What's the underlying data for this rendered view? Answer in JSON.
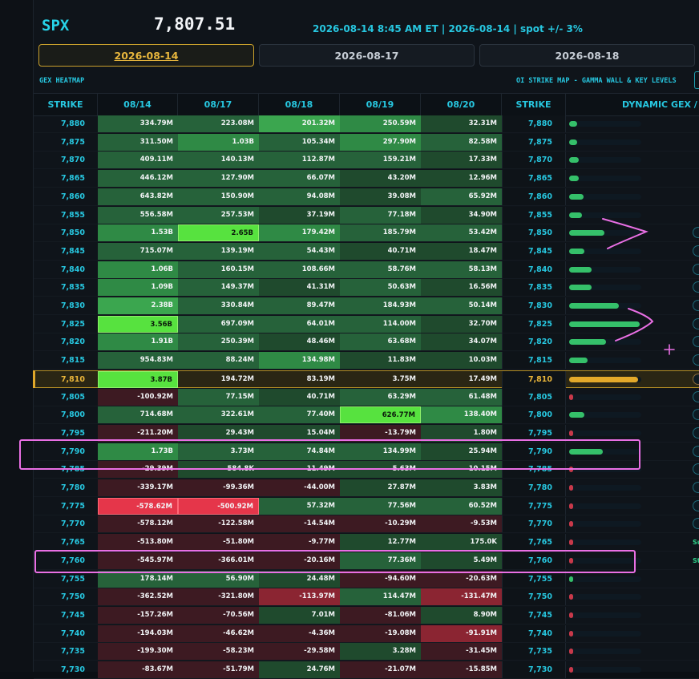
{
  "header": {
    "symbol": "SPX",
    "spot_price": "7,807.51",
    "meta": "2026-08-14 8:45 AM ET | 2026-08-14 | spot +/- 3%"
  },
  "expiry_tabs": [
    {
      "label": "2026-08-14",
      "active": true
    },
    {
      "label": "2026-08-17",
      "active": false
    },
    {
      "label": "2026-08-18",
      "active": false
    }
  ],
  "sections": {
    "left": "GEX HEATMAP",
    "right": "OI STRIKE MAP - GAMMA WALL & KEY LEVELS"
  },
  "table": {
    "columns": [
      "STRIKE",
      "08/14",
      "08/17",
      "08/18",
      "08/19",
      "08/20",
      "STRIKE",
      "DYNAMIC GEX / ST"
    ],
    "rows": [
      {
        "strike": "7,880",
        "cells": [
          {
            "v": "334.79M",
            "t": 2
          },
          {
            "v": "223.08M",
            "t": 2
          },
          {
            "v": "201.32M",
            "t": 4
          },
          {
            "v": "250.59M",
            "t": 3
          },
          {
            "v": "32.31M",
            "t": 1
          }
        ],
        "bar": 0.11,
        "badge": false
      },
      {
        "strike": "7,875",
        "cells": [
          {
            "v": "311.50M",
            "t": 2
          },
          {
            "v": "1.03B",
            "t": 3
          },
          {
            "v": "105.34M",
            "t": 2
          },
          {
            "v": "297.90M",
            "t": 3
          },
          {
            "v": "82.58M",
            "t": 2
          }
        ],
        "bar": 0.11,
        "badge": false
      },
      {
        "strike": "7,870",
        "cells": [
          {
            "v": "409.11M",
            "t": 2
          },
          {
            "v": "140.13M",
            "t": 2
          },
          {
            "v": "112.87M",
            "t": 2
          },
          {
            "v": "159.21M",
            "t": 2
          },
          {
            "v": "17.33M",
            "t": 1
          }
        ],
        "bar": 0.14,
        "badge": false
      },
      {
        "strike": "7,865",
        "cells": [
          {
            "v": "446.12M",
            "t": 2
          },
          {
            "v": "127.90M",
            "t": 2
          },
          {
            "v": "66.07M",
            "t": 2
          },
          {
            "v": "43.20M",
            "t": 1
          },
          {
            "v": "12.96M",
            "t": 1
          }
        ],
        "bar": 0.14,
        "badge": false
      },
      {
        "strike": "7,860",
        "cells": [
          {
            "v": "643.82M",
            "t": 2
          },
          {
            "v": "150.90M",
            "t": 2
          },
          {
            "v": "94.08M",
            "t": 2
          },
          {
            "v": "39.08M",
            "t": 1
          },
          {
            "v": "65.92M",
            "t": 2
          }
        ],
        "bar": 0.2,
        "badge": false
      },
      {
        "strike": "7,855",
        "cells": [
          {
            "v": "556.58M",
            "t": 2
          },
          {
            "v": "257.53M",
            "t": 2
          },
          {
            "v": "37.19M",
            "t": 1
          },
          {
            "v": "77.18M",
            "t": 2
          },
          {
            "v": "34.90M",
            "t": 1
          }
        ],
        "bar": 0.18,
        "badge": false
      },
      {
        "strike": "7,850",
        "cells": [
          {
            "v": "1.53B",
            "t": 3
          },
          {
            "v": "2.65B",
            "t": 5
          },
          {
            "v": "179.42M",
            "t": 3
          },
          {
            "v": "185.79M",
            "t": 2
          },
          {
            "v": "53.42M",
            "t": 2
          }
        ],
        "bar": 0.5,
        "badge": true
      },
      {
        "strike": "7,845",
        "cells": [
          {
            "v": "715.07M",
            "t": 2
          },
          {
            "v": "139.19M",
            "t": 2
          },
          {
            "v": "54.43M",
            "t": 2
          },
          {
            "v": "40.71M",
            "t": 1
          },
          {
            "v": "18.47M",
            "t": 1
          }
        ],
        "bar": 0.22,
        "badge": true
      },
      {
        "strike": "7,840",
        "cells": [
          {
            "v": "1.06B",
            "t": 3
          },
          {
            "v": "160.15M",
            "t": 2
          },
          {
            "v": "108.66M",
            "t": 2
          },
          {
            "v": "58.76M",
            "t": 2
          },
          {
            "v": "58.13M",
            "t": 2
          }
        ],
        "bar": 0.32,
        "badge": true
      },
      {
        "strike": "7,835",
        "cells": [
          {
            "v": "1.09B",
            "t": 3
          },
          {
            "v": "149.37M",
            "t": 2
          },
          {
            "v": "41.31M",
            "t": 1
          },
          {
            "v": "50.63M",
            "t": 2
          },
          {
            "v": "16.56M",
            "t": 1
          }
        ],
        "bar": 0.32,
        "badge": true
      },
      {
        "strike": "7,830",
        "cells": [
          {
            "v": "2.38B",
            "t": 4
          },
          {
            "v": "330.84M",
            "t": 2
          },
          {
            "v": "89.47M",
            "t": 2
          },
          {
            "v": "184.93M",
            "t": 2
          },
          {
            "v": "50.14M",
            "t": 2
          }
        ],
        "bar": 0.7,
        "badge": true
      },
      {
        "strike": "7,825",
        "cells": [
          {
            "v": "3.56B",
            "t": 5
          },
          {
            "v": "697.09M",
            "t": 2
          },
          {
            "v": "64.01M",
            "t": 2
          },
          {
            "v": "114.00M",
            "t": 2
          },
          {
            "v": "32.70M",
            "t": 1
          }
        ],
        "bar": 1.0,
        "badge": true
      },
      {
        "strike": "7,820",
        "cells": [
          {
            "v": "1.91B",
            "t": 3
          },
          {
            "v": "250.39M",
            "t": 2
          },
          {
            "v": "48.46M",
            "t": 1
          },
          {
            "v": "63.68M",
            "t": 2
          },
          {
            "v": "34.07M",
            "t": 1
          }
        ],
        "bar": 0.52,
        "badge": true
      },
      {
        "strike": "7,815",
        "cells": [
          {
            "v": "954.83M",
            "t": 2
          },
          {
            "v": "88.24M",
            "t": 2
          },
          {
            "v": "134.98M",
            "t": 3
          },
          {
            "v": "11.83M",
            "t": 1
          },
          {
            "v": "10.03M",
            "t": 1
          }
        ],
        "bar": 0.26,
        "badge": true
      },
      {
        "strike": "7,810",
        "spot": true,
        "cells": [
          {
            "v": "3.87B",
            "t": 5
          },
          {
            "v": "194.72M",
            "t": 0
          },
          {
            "v": "83.19M",
            "t": 0
          },
          {
            "v": "3.75M",
            "t": 0
          },
          {
            "v": "17.49M",
            "t": 0
          }
        ],
        "bar": 0.98,
        "badge": true
      },
      {
        "strike": "7,805",
        "cells": [
          {
            "v": "-100.92M",
            "t": -1
          },
          {
            "v": "77.15M",
            "t": 2
          },
          {
            "v": "40.71M",
            "t": 1
          },
          {
            "v": "63.29M",
            "t": 2
          },
          {
            "v": "61.48M",
            "t": 2
          }
        ],
        "bar": -0.02,
        "badge": true
      },
      {
        "strike": "7,800",
        "cells": [
          {
            "v": "714.68M",
            "t": 2
          },
          {
            "v": "322.61M",
            "t": 2
          },
          {
            "v": "77.40M",
            "t": 2
          },
          {
            "v": "626.77M",
            "t": 5
          },
          {
            "v": "138.40M",
            "t": 3
          }
        ],
        "bar": 0.22,
        "badge": true
      },
      {
        "strike": "7,795",
        "cells": [
          {
            "v": "-211.20M",
            "t": -1
          },
          {
            "v": "29.43M",
            "t": 1
          },
          {
            "v": "15.04M",
            "t": 1
          },
          {
            "v": "-13.79M",
            "t": -1
          },
          {
            "v": "1.80M",
            "t": 1
          }
        ],
        "bar": -0.02,
        "badge": true
      },
      {
        "strike": "7,790",
        "cells": [
          {
            "v": "1.73B",
            "t": 3
          },
          {
            "v": "3.73M",
            "t": 2
          },
          {
            "v": "74.84M",
            "t": 2
          },
          {
            "v": "134.99M",
            "t": 2
          },
          {
            "v": "25.94M",
            "t": 1
          }
        ],
        "bar": 0.48,
        "badge": true
      },
      {
        "strike": "7,785",
        "cells": [
          {
            "v": "-29.39M",
            "t": -1
          },
          {
            "v": "584.8K",
            "t": 1
          },
          {
            "v": "11.49M",
            "t": 1
          },
          {
            "v": "5.63M",
            "t": 1
          },
          {
            "v": "10.15M",
            "t": 1
          }
        ],
        "bar": -0.01,
        "badge": true
      },
      {
        "strike": "7,780",
        "cells": [
          {
            "v": "-339.17M",
            "t": -1
          },
          {
            "v": "-99.36M",
            "t": -1
          },
          {
            "v": "-44.00M",
            "t": -1
          },
          {
            "v": "27.87M",
            "t": 1
          },
          {
            "v": "3.83M",
            "t": 1
          }
        ],
        "bar": -0.02,
        "badge": true
      },
      {
        "strike": "7,775",
        "cells": [
          {
            "v": "-578.62M",
            "t": -3
          },
          {
            "v": "-500.92M",
            "t": -3
          },
          {
            "v": "57.32M",
            "t": 2
          },
          {
            "v": "77.56M",
            "t": 2
          },
          {
            "v": "60.52M",
            "t": 2
          }
        ],
        "bar": -0.04,
        "badge": true
      },
      {
        "strike": "7,770",
        "cells": [
          {
            "v": "-578.12M",
            "t": -1
          },
          {
            "v": "-122.58M",
            "t": -1
          },
          {
            "v": "-14.54M",
            "t": -1
          },
          {
            "v": "-10.29M",
            "t": -1
          },
          {
            "v": "-9.53M",
            "t": -1
          }
        ],
        "bar": -0.04,
        "badge": true
      },
      {
        "strike": "7,765",
        "cells": [
          {
            "v": "-513.80M",
            "t": -1
          },
          {
            "v": "-51.80M",
            "t": -1
          },
          {
            "v": "-9.77M",
            "t": -1
          },
          {
            "v": "12.77M",
            "t": 1
          },
          {
            "v": "175.0K",
            "t": 1
          }
        ],
        "bar": -0.04,
        "badge": false,
        "side": "Su"
      },
      {
        "strike": "7,760",
        "cells": [
          {
            "v": "-545.97M",
            "t": -1
          },
          {
            "v": "-366.01M",
            "t": -1
          },
          {
            "v": "-20.16M",
            "t": -1
          },
          {
            "v": "77.36M",
            "t": 2
          },
          {
            "v": "5.49M",
            "t": 1
          }
        ],
        "bar": -0.04,
        "badge": false,
        "side": "St"
      },
      {
        "strike": "7,755",
        "cells": [
          {
            "v": "178.14M",
            "t": 2
          },
          {
            "v": "56.90M",
            "t": 2
          },
          {
            "v": "24.48M",
            "t": 1
          },
          {
            "v": "-94.60M",
            "t": -1
          },
          {
            "v": "-20.63M",
            "t": -1
          }
        ],
        "bar": 0.03,
        "badge": false
      },
      {
        "strike": "7,750",
        "cells": [
          {
            "v": "-362.52M",
            "t": -1
          },
          {
            "v": "-321.80M",
            "t": -1
          },
          {
            "v": "-113.97M",
            "t": -2
          },
          {
            "v": "114.47M",
            "t": 2
          },
          {
            "v": "-131.47M",
            "t": -2
          }
        ],
        "bar": -0.01,
        "badge": false
      },
      {
        "strike": "7,745",
        "cells": [
          {
            "v": "-157.26M",
            "t": -1
          },
          {
            "v": "-70.56M",
            "t": -1
          },
          {
            "v": "7.01M",
            "t": 1
          },
          {
            "v": "-81.06M",
            "t": -1
          },
          {
            "v": "8.90M",
            "t": 1
          }
        ],
        "bar": -0.01,
        "badge": false
      },
      {
        "strike": "7,740",
        "cells": [
          {
            "v": "-194.03M",
            "t": -1
          },
          {
            "v": "-46.62M",
            "t": -1
          },
          {
            "v": "-4.36M",
            "t": -1
          },
          {
            "v": "-19.08M",
            "t": -1
          },
          {
            "v": "-91.91M",
            "t": -2
          }
        ],
        "bar": -0.01,
        "badge": false
      },
      {
        "strike": "7,735",
        "cells": [
          {
            "v": "-199.30M",
            "t": -1
          },
          {
            "v": "-58.23M",
            "t": -1
          },
          {
            "v": "-29.58M",
            "t": -1
          },
          {
            "v": "3.28M",
            "t": 1
          },
          {
            "v": "-31.45M",
            "t": -1
          }
        ],
        "bar": -0.01,
        "badge": false
      },
      {
        "strike": "7,730",
        "cells": [
          {
            "v": "-83.67M",
            "t": -1
          },
          {
            "v": "-51.79M",
            "t": -1
          },
          {
            "v": "24.76M",
            "t": 1
          },
          {
            "v": "-21.07M",
            "t": -1
          },
          {
            "v": "-15.85M",
            "t": -1
          }
        ],
        "bar": -0.01,
        "badge": false
      }
    ]
  },
  "colors": {
    "accent_cyan": "#27c7e0",
    "spot_gold": "#e0a82a",
    "annotation_pink": "#e96fe4",
    "pos_1": "#1f4a2d",
    "pos_2": "#26623a",
    "pos_3": "#2f8a45",
    "pos_4": "#3ba64f",
    "pos_5": "#57e23f",
    "neg_1": "#3d1a22",
    "neg_2": "#8b2532",
    "neg_3": "#e5364a"
  },
  "icons": {
    "annotation_arrow_1": "chevron-right-scribble",
    "annotation_arrow_2": "chevron-right-scribble",
    "annotation_plus": "plus-mark"
  }
}
